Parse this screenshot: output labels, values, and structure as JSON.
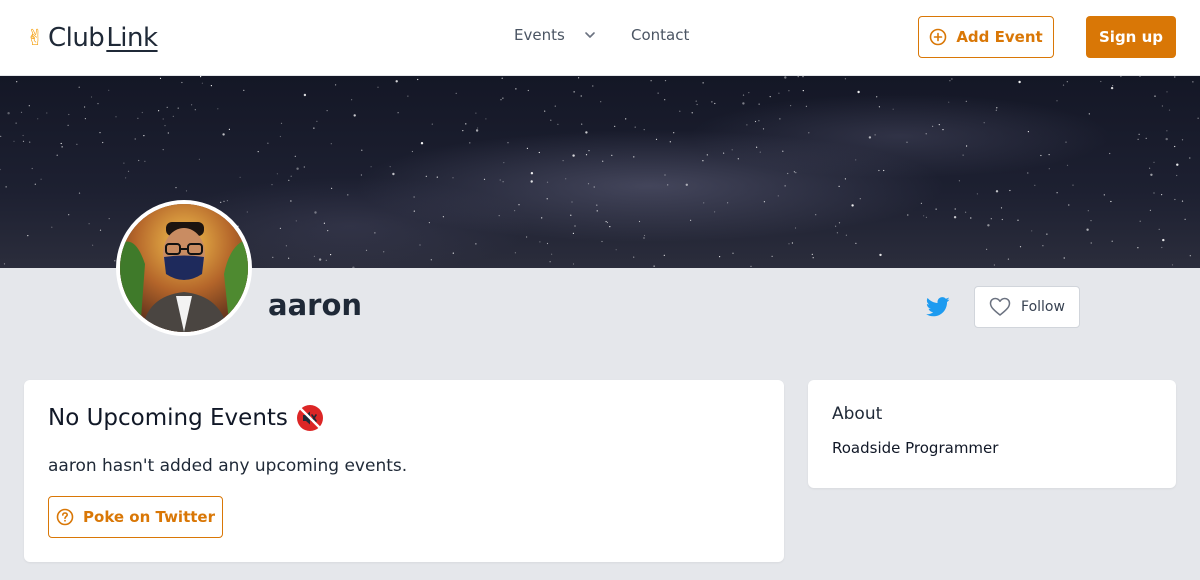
{
  "header": {
    "logo_text_club": "Club",
    "logo_text_link": "Link",
    "logo_icon": "victory-hand-icon",
    "nav": {
      "events_label": "Events",
      "contact_label": "Contact"
    },
    "add_event_label": "Add Event",
    "sign_up_label": "Sign up"
  },
  "profile": {
    "username": "aaron",
    "follow_label": "Follow",
    "social_icon": "twitter-icon"
  },
  "events_section": {
    "title": "No Upcoming Events",
    "title_icon": "muted-speaker-icon",
    "message": "aaron hasn't added any upcoming events.",
    "poke_label": "Poke on Twitter"
  },
  "about": {
    "title": "About",
    "bio": "Roadside Programmer"
  },
  "colors": {
    "accent": "#d97706",
    "page_bg": "#e5e7eb",
    "twitter_blue": "#1d9bf0"
  }
}
